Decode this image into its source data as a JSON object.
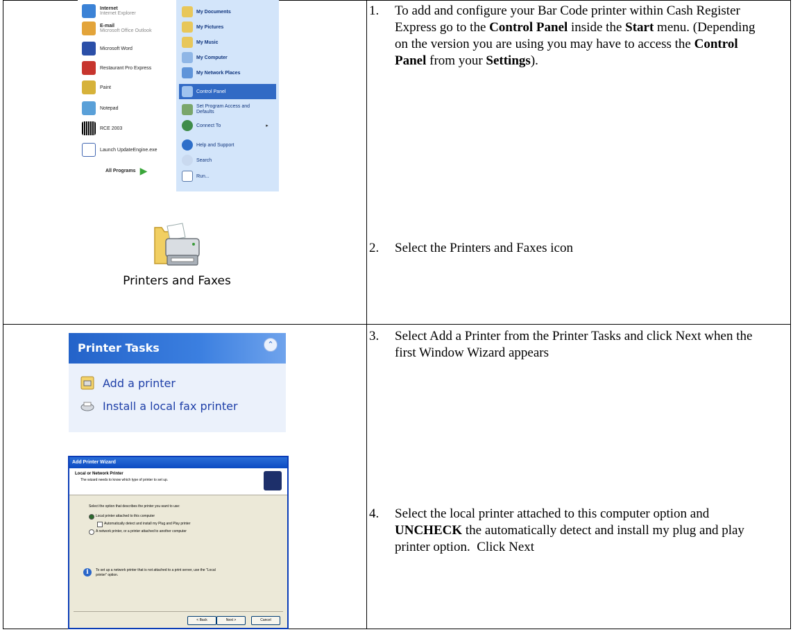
{
  "steps": [
    {
      "number": "1.",
      "text_html": "To add and configure your Bar Code printer within Cash Register Express go to the <b>Control Panel</b> inside the <b>Start</b> menu. (Depending on the version you are using you may have to access the <b>Control Panel</b> from your <b>Settings</b>)."
    },
    {
      "number": "2.",
      "text": "Select the Printers and Faxes icon"
    },
    {
      "number": "3.",
      "text": "Select Add a Printer from the Printer Tasks and click Next when the first Window Wizard appears"
    },
    {
      "number": "4.",
      "text_html": "Select the local printer attached to this computer option and <b>UNCHECK</b> the automatically detect and install my plug and play printer option.&nbsp; Click Next"
    }
  ],
  "start_menu": {
    "left_items": [
      "Internet",
      "E-mail",
      "Microsoft Word",
      "Restaurant Pro Express",
      "Paint",
      "Notepad",
      "RCE 2003",
      "Launch UpdateEngine.exe"
    ],
    "left_subtitles": [
      "Internet Explorer",
      "Microsoft Office Outlook"
    ],
    "all_programs": "All Programs",
    "right_items": [
      "My Documents",
      "My Pictures",
      "My Music",
      "My Computer",
      "My Network Places",
      "Control Panel",
      "Set Program Access and Defaults",
      "Connect To",
      "Help and Support",
      "Search",
      "Run..."
    ],
    "selected": "Control Panel"
  },
  "printers_faxes": {
    "label": "Printers and Faxes"
  },
  "printer_tasks": {
    "title": "Printer Tasks",
    "items": [
      "Add a printer",
      "Install a local fax printer"
    ]
  },
  "wizard": {
    "title": "Add Printer Wizard",
    "heading": "Local or Network Printer",
    "subheading": "The wizard needs to know which type of printer to set up.",
    "prompt": "Select the option that describes the printer you want to use:",
    "option_local": "Local printer attached to this computer",
    "option_auto": "Automatically detect and install my Plug and Play printer",
    "option_network": "A network printer, or a printer attached to another computer",
    "info": "To set up a network printer that is not attached to a print server, use the \"Local printer\" option.",
    "buttons": [
      "< Back",
      "Next >",
      "Cancel"
    ]
  },
  "colors": {
    "xp_blue": "#2463c9",
    "selection": "#316ac5",
    "task_bg": "#ebf1fb"
  }
}
